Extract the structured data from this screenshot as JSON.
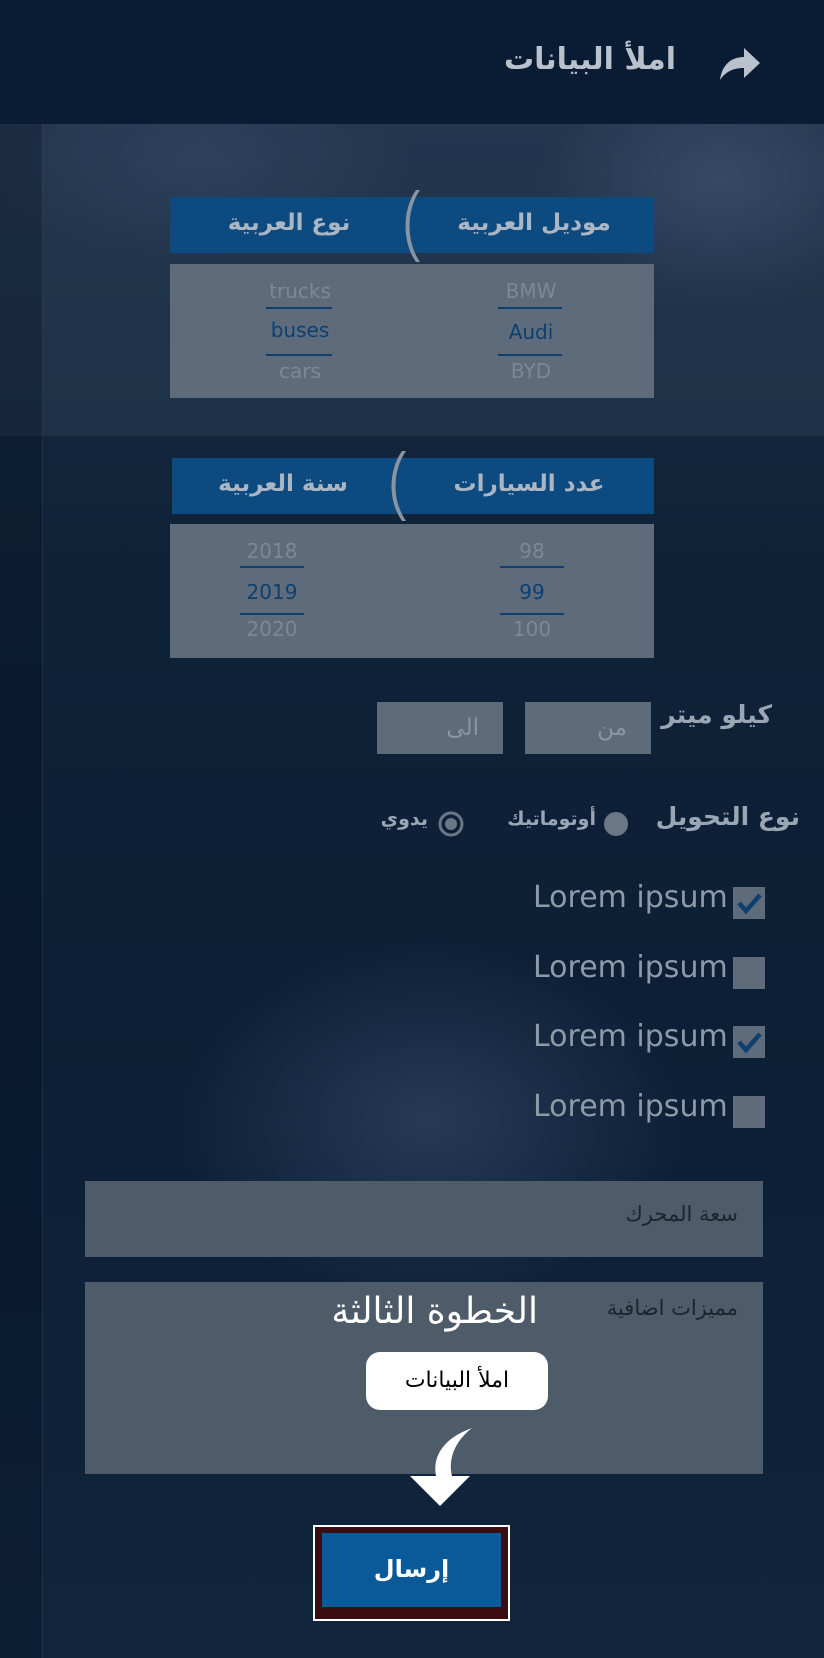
{
  "header": {
    "title": "املأ البيانات",
    "share_icon": "share-forward-icon"
  },
  "car_picker": {
    "model_label": "موديل العربية",
    "type_label": "نوع العربية",
    "models": [
      "BMW",
      "Audi",
      "BYD"
    ],
    "types": [
      "trucks",
      "buses",
      "cars"
    ],
    "selected_model": "Audi",
    "selected_type": "buses"
  },
  "count_picker": {
    "count_label": "عدد السيارات",
    "year_label": "سنة العربية",
    "counts": [
      "98",
      "99",
      "100"
    ],
    "years": [
      "2018",
      "2019",
      "2020"
    ],
    "selected_count": "99",
    "selected_year": "2019"
  },
  "km": {
    "label": "كيلو ميتر",
    "from_placeholder": "من",
    "to_placeholder": "الى"
  },
  "transmission": {
    "label": "نوع التحويل",
    "options": [
      "أوتوماتيك",
      "يدوي"
    ],
    "selected": "يدوي"
  },
  "features": [
    {
      "label": "Lorem ipsum",
      "checked": true
    },
    {
      "label": "Lorem ipsum",
      "checked": false
    },
    {
      "label": "Lorem ipsum",
      "checked": true
    },
    {
      "label": "Lorem ipsum",
      "checked": false
    }
  ],
  "engine_field": {
    "placeholder": "سعة المحرك"
  },
  "extras_field": {
    "placeholder": "مميزات اضافية"
  },
  "tutorial": {
    "step_title": "الخطوة الثالثة",
    "step_hint": "املأ البيانات"
  },
  "submit_label": "إرسال",
  "colors": {
    "header": "#091c33",
    "accent": "#0a5a9a",
    "pill": "#0c4a80",
    "field": "#5d6b7b"
  }
}
